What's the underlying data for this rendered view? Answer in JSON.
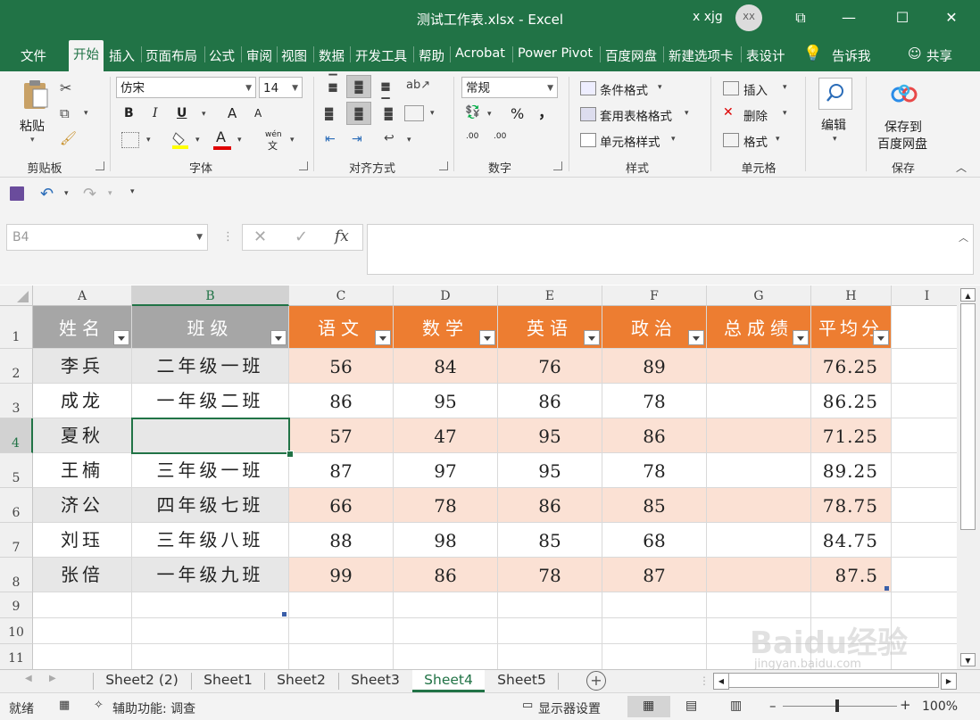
{
  "window": {
    "title": "测试工作表.xlsx  -  Excel",
    "user": "x xjg",
    "avatar": "XX",
    "min": "—",
    "max": "☐",
    "close": "✕",
    "restore": "⧉"
  },
  "tabs": [
    "文件",
    "开始",
    "插入",
    "页面布局",
    "公式",
    "审阅",
    "视图",
    "数据",
    "开发工具",
    "帮助",
    "Acrobat",
    "Power Pivot",
    "百度网盘",
    "新建选项卡",
    "表设计"
  ],
  "active_tab": "开始",
  "tell_me": "告诉我",
  "share": "共享",
  "ribbon": {
    "clipboard": {
      "paste": "粘贴",
      "label": "剪贴板"
    },
    "font": {
      "name": "仿宋",
      "size": "14",
      "bold": "B",
      "italic": "I",
      "underline": "U",
      "grow": "A",
      "shrink": "A",
      "color_letter": "A",
      "label": "字体",
      "wen": "wén",
      "wen2": "文"
    },
    "align": {
      "label": "对齐方式"
    },
    "number": {
      "format": "常规",
      "percent": "%",
      "comma": "，",
      "inc": ".00",
      "dec": ".00",
      "label": "数字"
    },
    "styles": {
      "cond": "条件格式",
      "table": "套用表格格式",
      "cell": "单元格样式",
      "label": "样式"
    },
    "cells": {
      "insert": "插入",
      "delete": "删除",
      "format": "格式",
      "label": "单元格"
    },
    "edit": {
      "label": "编辑"
    },
    "save": {
      "line1": "保存到",
      "line2": "百度网盘",
      "label": "保存"
    }
  },
  "formula_bar": {
    "name_box": "B4",
    "cancel": "✕",
    "enter": "✓",
    "fx": "fx",
    "formula": ""
  },
  "columns": [
    "A",
    "B",
    "C",
    "D",
    "E",
    "F",
    "G",
    "H",
    "I"
  ],
  "selected_column": "B",
  "rows": [
    "1",
    "2",
    "3",
    "4",
    "5",
    "6",
    "7",
    "8",
    "9",
    "10",
    "11"
  ],
  "selected_row": "4",
  "table": {
    "headers": [
      "姓名",
      "班级",
      "语文",
      "数学",
      "英语",
      "政治",
      "总成绩",
      "平均分"
    ],
    "data": [
      [
        "李兵",
        "二年级一班",
        "56",
        "84",
        "76",
        "89",
        "",
        "76.25"
      ],
      [
        "成龙",
        "一年级二班",
        "86",
        "95",
        "86",
        "78",
        "",
        "86.25"
      ],
      [
        "夏秋",
        "",
        "57",
        "47",
        "95",
        "86",
        "",
        "71.25"
      ],
      [
        "王楠",
        "三年级一班",
        "87",
        "97",
        "95",
        "78",
        "",
        "89.25"
      ],
      [
        "济公",
        "四年级七班",
        "66",
        "78",
        "86",
        "85",
        "",
        "78.75"
      ],
      [
        "刘珏",
        "三年级八班",
        "88",
        "98",
        "85",
        "68",
        "",
        "84.75"
      ],
      [
        "张倍",
        "一年级九班",
        "99",
        "86",
        "78",
        "87",
        "",
        "87.5"
      ]
    ]
  },
  "colors": {
    "excel_green": "#217346",
    "header_gray": "#a6a6a6",
    "header_orange": "#ed7d31",
    "band_gray": "#e7e7e7",
    "band_orange": "#fbe1d4"
  },
  "sheets": [
    "Sheet2 (2)",
    "Sheet1",
    "Sheet2",
    "Sheet3",
    "Sheet4",
    "Sheet5"
  ],
  "active_sheet": "Sheet4",
  "status": {
    "ready": "就绪",
    "accessibility": "辅助功能: 调查",
    "display": "显示器设置",
    "zoom": "100%"
  },
  "watermark": {
    "brand": "Baidu经验",
    "url": "jingyan.baidu.com"
  }
}
